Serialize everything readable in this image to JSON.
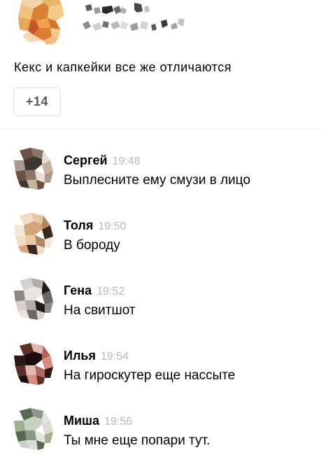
{
  "post": {
    "text": "Кекс и капкейки все же отличаются",
    "more_replies_label": "+14"
  },
  "comments": [
    {
      "author": "Сергей",
      "time": "19:48",
      "text": "Выплесните ему смузи в лицо",
      "avatar_colors": [
        "#6b5344",
        "#c6b39b",
        "#3e3733",
        "#a89a8e",
        "#e7ddd2",
        "#8c7566"
      ]
    },
    {
      "author": "Толя",
      "time": "19:50",
      "text": "В бороду",
      "avatar_colors": [
        "#e8c8a4",
        "#f2dcc2",
        "#3a2a22",
        "#d4a679",
        "#f6e6d6",
        "#b08560"
      ]
    },
    {
      "author": "Гена",
      "time": "19:52",
      "text": "На свитшот",
      "avatar_colors": [
        "#1e1b1a",
        "#b4ada7",
        "#d7d1cb",
        "#6e6661",
        "#e8e4e1",
        "#8f8782"
      ]
    },
    {
      "author": "Илья",
      "time": "19:54",
      "text": "На гироскутер еще нассыте",
      "avatar_colors": [
        "#2b1915",
        "#b0645e",
        "#e2b8ae",
        "#5e2e29",
        "#d78d80",
        "#1a0f0d"
      ]
    },
    {
      "author": "Миша",
      "time": "19:56",
      "text": "Ты мне еще попари тут.",
      "avatar_colors": [
        "#c9d1c3",
        "#a2b08f",
        "#e3e6e0",
        "#8a9a86",
        "#556b4f",
        "#d8ddd4"
      ]
    }
  ],
  "colors": {
    "time_gray": "#b5b9be",
    "button_border": "#dcdfe3",
    "button_text": "#545c63",
    "divider": "#e6e8ec"
  }
}
